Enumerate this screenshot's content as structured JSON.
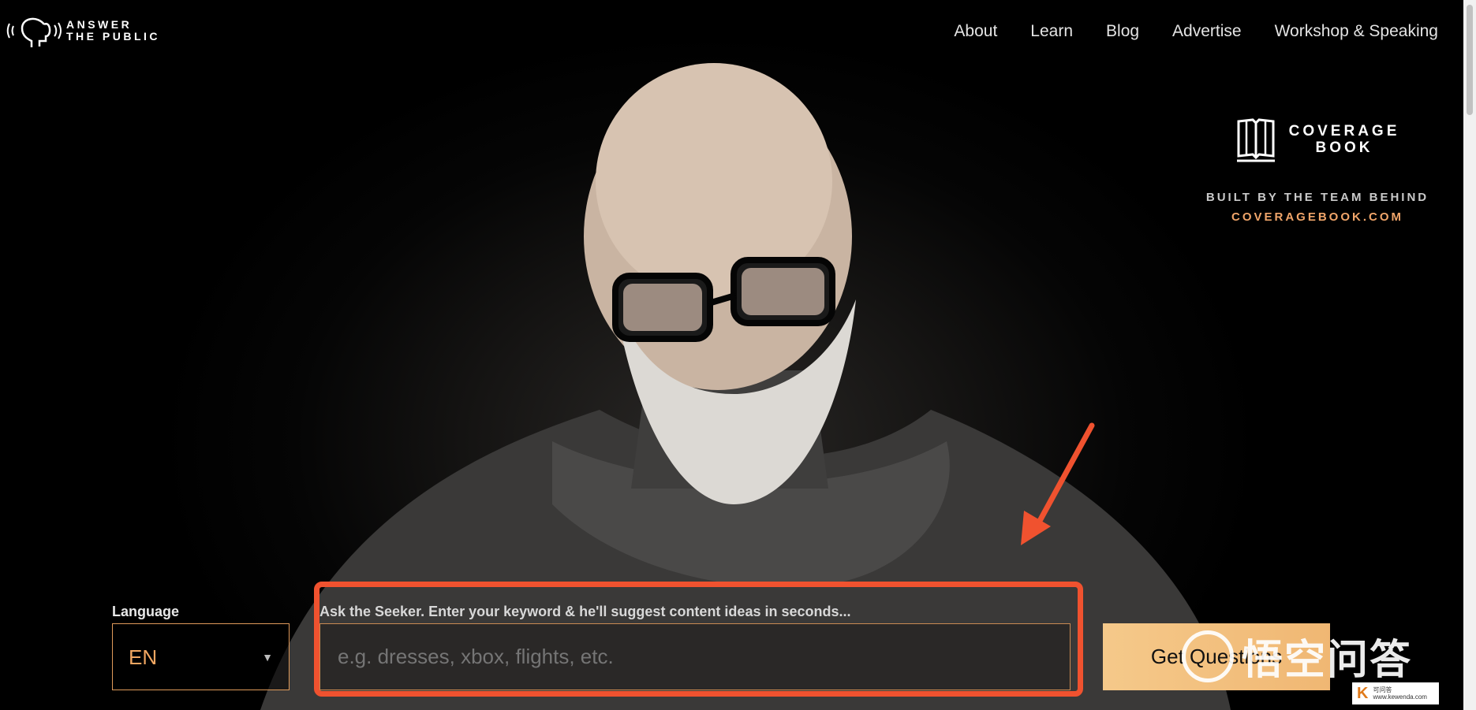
{
  "header": {
    "logo_line1": "ANSWER",
    "logo_line2": "THE PUBLIC",
    "nav": [
      "About",
      "Learn",
      "Blog",
      "Advertise",
      "Workshop & Speaking"
    ]
  },
  "promo": {
    "brand_line1": "COVERAGE",
    "brand_line2": "BOOK",
    "tagline": "BUILT BY THE TEAM BEHIND",
    "link": "COVERAGEBOOK.COM"
  },
  "search": {
    "language_label": "Language",
    "language_value": "EN",
    "query_label": "Ask the Seeker. Enter your keyword & he'll suggest content ideas in seconds...",
    "query_placeholder": "e.g. dresses, xbox, flights, etc.",
    "query_value": "",
    "button_label": "Get Questions"
  },
  "watermark": {
    "text": "悟空问答",
    "badge_letter": "K",
    "badge_text": "可问答",
    "badge_url": "www.kewenda.com"
  },
  "colors": {
    "accent": "#f0a56a",
    "highlight": "#f0522f",
    "cta": "#f5c98a"
  },
  "icons": {
    "logo": "speaking-head-icon",
    "promo": "open-book-icon",
    "caret": "caret-down-icon",
    "arrow": "annotation-arrow"
  }
}
